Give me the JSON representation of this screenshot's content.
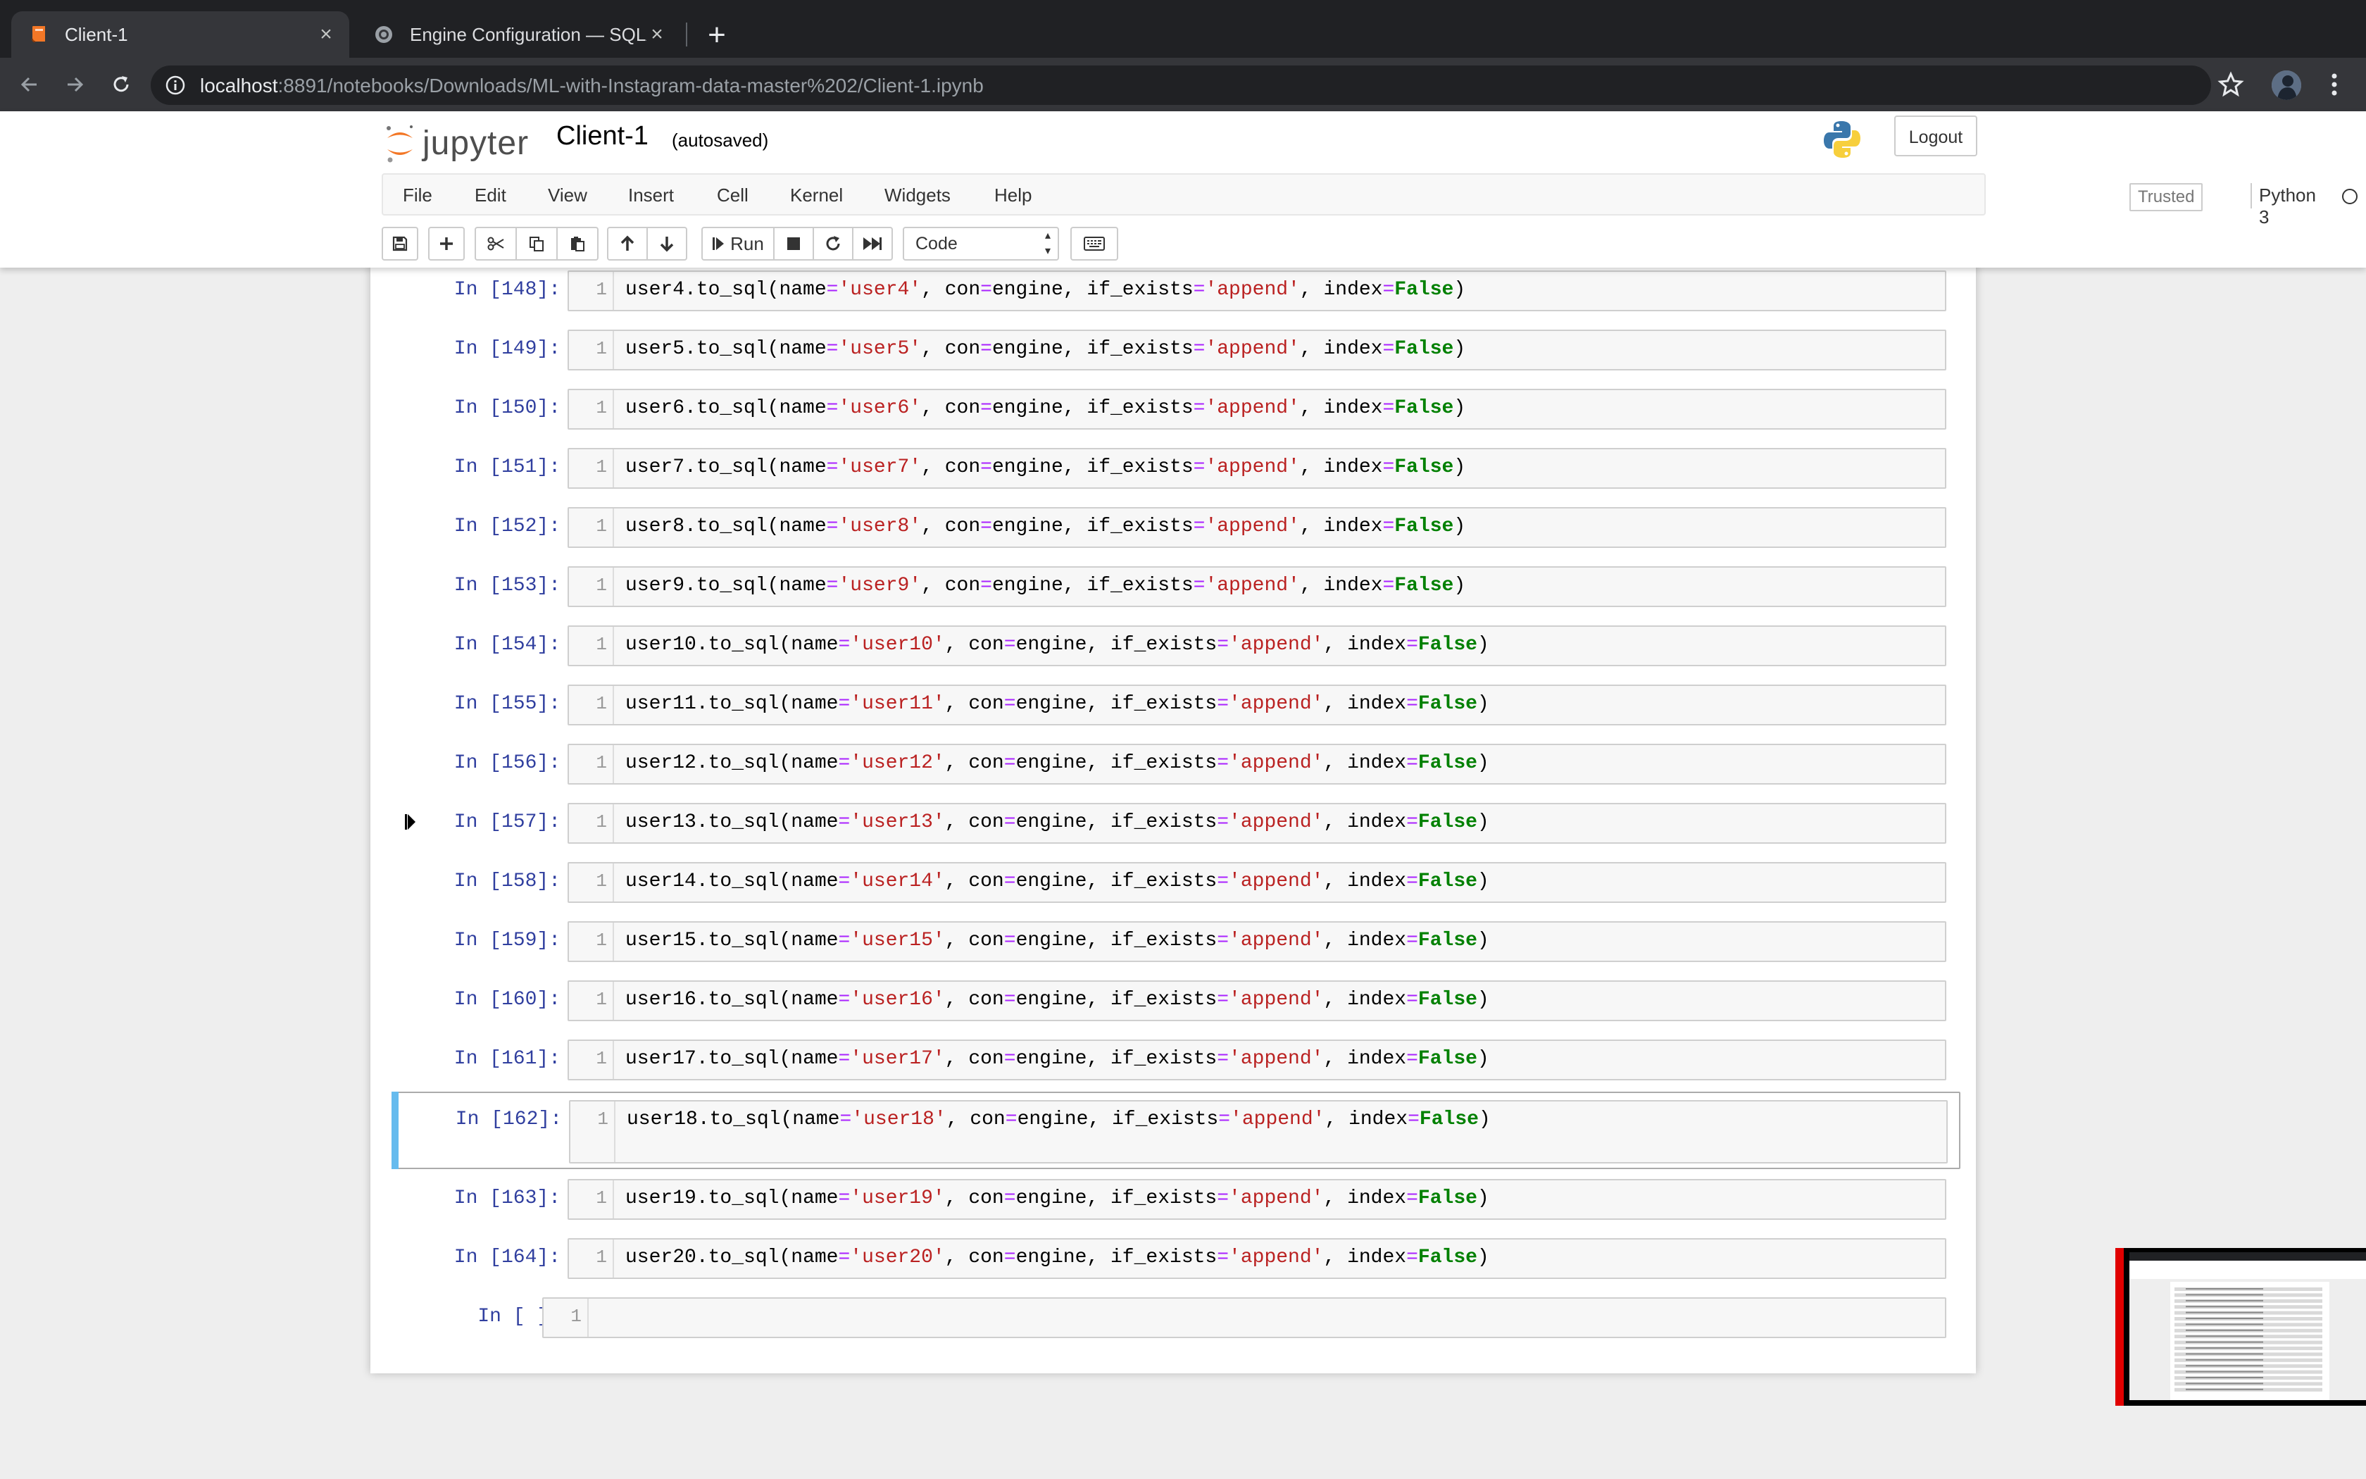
{
  "browser": {
    "tabs": [
      {
        "title": "Client-1",
        "active": true
      },
      {
        "title": "Engine Configuration — SQLAlchemy",
        "active": false
      }
    ],
    "url_host": "localhost",
    "url_rest": ":8891/notebooks/Downloads/ML-with-Instagram-data-master%202/Client-1.ipynb"
  },
  "jupyter": {
    "logo_text": "jupyter",
    "notebook_name": "Client-1",
    "autosave_status": "(autosaved)",
    "logout_label": "Logout",
    "menu": [
      "File",
      "Edit",
      "View",
      "Insert",
      "Cell",
      "Kernel",
      "Widgets",
      "Help"
    ],
    "trusted_label": "Trusted",
    "kernel_name": "Python 3",
    "run_label": "Run",
    "cell_type": "Code"
  },
  "cells": [
    {
      "prompt": "In [148]:",
      "line": "1",
      "var": "user4",
      "table": "'user4'"
    },
    {
      "prompt": "In [149]:",
      "line": "1",
      "var": "user5",
      "table": "'user5'"
    },
    {
      "prompt": "In [150]:",
      "line": "1",
      "var": "user6",
      "table": "'user6'"
    },
    {
      "prompt": "In [151]:",
      "line": "1",
      "var": "user7",
      "table": "'user7'"
    },
    {
      "prompt": "In [152]:",
      "line": "1",
      "var": "user8",
      "table": "'user8'"
    },
    {
      "prompt": "In [153]:",
      "line": "1",
      "var": "user9",
      "table": "'user9'"
    },
    {
      "prompt": "In [154]:",
      "line": "1",
      "var": "user10",
      "table": "'user10'"
    },
    {
      "prompt": "In [155]:",
      "line": "1",
      "var": "user11",
      "table": "'user11'"
    },
    {
      "prompt": "In [156]:",
      "line": "1",
      "var": "user12",
      "table": "'user12'"
    },
    {
      "prompt": "In [157]:",
      "line": "1",
      "var": "user13",
      "table": "'user13'"
    },
    {
      "prompt": "In [158]:",
      "line": "1",
      "var": "user14",
      "table": "'user14'"
    },
    {
      "prompt": "In [159]:",
      "line": "1",
      "var": "user15",
      "table": "'user15'"
    },
    {
      "prompt": "In [160]:",
      "line": "1",
      "var": "user16",
      "table": "'user16'"
    },
    {
      "prompt": "In [161]:",
      "line": "1",
      "var": "user17",
      "table": "'user17'"
    },
    {
      "prompt": "In [162]:",
      "line": "1",
      "var": "user18",
      "table": "'user18'",
      "selected": true
    },
    {
      "prompt": "In [163]:",
      "line": "1",
      "var": "user19",
      "table": "'user19'"
    },
    {
      "prompt": "In [164]:",
      "line": "1",
      "var": "user20",
      "table": "'user20'"
    },
    {
      "prompt": "In [ ]:",
      "line": "1",
      "empty": true
    }
  ],
  "code_parts": {
    "method": ".to_sql",
    "open": "(",
    "name_kw": "name",
    "eq": "=",
    "comma": ", ",
    "con_kw": "con",
    "engine": "engine",
    "if_exists_kw": "if_exists",
    "append_str": "'append'",
    "index_kw": "index",
    "false_kw": "False",
    "close": ")"
  },
  "colors": {
    "prompt": "#303f9f",
    "string": "#ba2121",
    "keyword": "#008000",
    "operator": "#aa22ff",
    "selection_bar": "#66bbee"
  }
}
